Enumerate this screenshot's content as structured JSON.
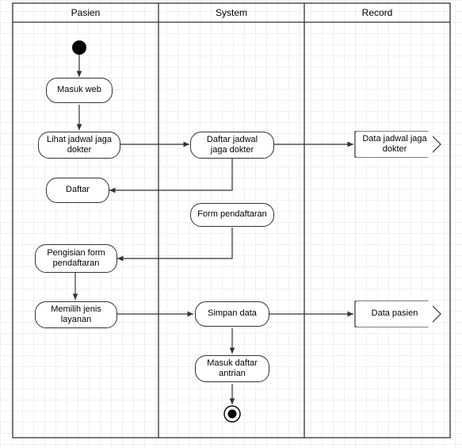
{
  "chart_data": {
    "type": "uml-activity",
    "lanes": [
      {
        "id": "pasien",
        "label": "Pasien"
      },
      {
        "id": "system",
        "label": "System"
      },
      {
        "id": "record",
        "label": "Record"
      }
    ],
    "nodes": [
      {
        "id": "start",
        "lane": "pasien",
        "kind": "initial"
      },
      {
        "id": "masuk-web",
        "lane": "pasien",
        "kind": "activity",
        "label": "Masuk web"
      },
      {
        "id": "lihat-jadwal",
        "lane": "pasien",
        "kind": "activity",
        "label": "Lihat jadwal jaga\ndokter"
      },
      {
        "id": "daftar-jadwal",
        "lane": "system",
        "kind": "activity",
        "label": "Daftar jadwal jaga\ndokter"
      },
      {
        "id": "data-jadwal",
        "lane": "record",
        "kind": "datastore",
        "label": "Data jadwal jaga\ndokter"
      },
      {
        "id": "daftar",
        "lane": "pasien",
        "kind": "activity",
        "label": "Daftar"
      },
      {
        "id": "form-pendaftaran",
        "lane": "system",
        "kind": "activity",
        "label": "Form pendaftaran"
      },
      {
        "id": "pengisian-form",
        "lane": "pasien",
        "kind": "activity",
        "label": "Pengisian form\npendaftaran"
      },
      {
        "id": "memilih-layanan",
        "lane": "pasien",
        "kind": "activity",
        "label": "Memilih jenis\nlayanan"
      },
      {
        "id": "simpan-data",
        "lane": "system",
        "kind": "activity",
        "label": "Simpan data"
      },
      {
        "id": "data-pasien",
        "lane": "record",
        "kind": "datastore",
        "label": "Data pasien"
      },
      {
        "id": "masuk-antrian",
        "lane": "system",
        "kind": "activity",
        "label": "Masuk daftar\nantrian"
      },
      {
        "id": "end",
        "lane": "system",
        "kind": "final"
      }
    ],
    "edges": [
      [
        "start",
        "masuk-web"
      ],
      [
        "masuk-web",
        "lihat-jadwal"
      ],
      [
        "lihat-jadwal",
        "daftar-jadwal"
      ],
      [
        "daftar-jadwal",
        "data-jadwal"
      ],
      [
        "daftar-jadwal",
        "daftar"
      ],
      [
        "daftar",
        "form-pendaftaran"
      ],
      [
        "form-pendaftaran",
        "pengisian-form"
      ],
      [
        "pengisian-form",
        "memilih-layanan"
      ],
      [
        "memilih-layanan",
        "simpan-data"
      ],
      [
        "simpan-data",
        "data-pasien"
      ],
      [
        "simpan-data",
        "masuk-antrian"
      ],
      [
        "masuk-antrian",
        "end"
      ]
    ]
  }
}
